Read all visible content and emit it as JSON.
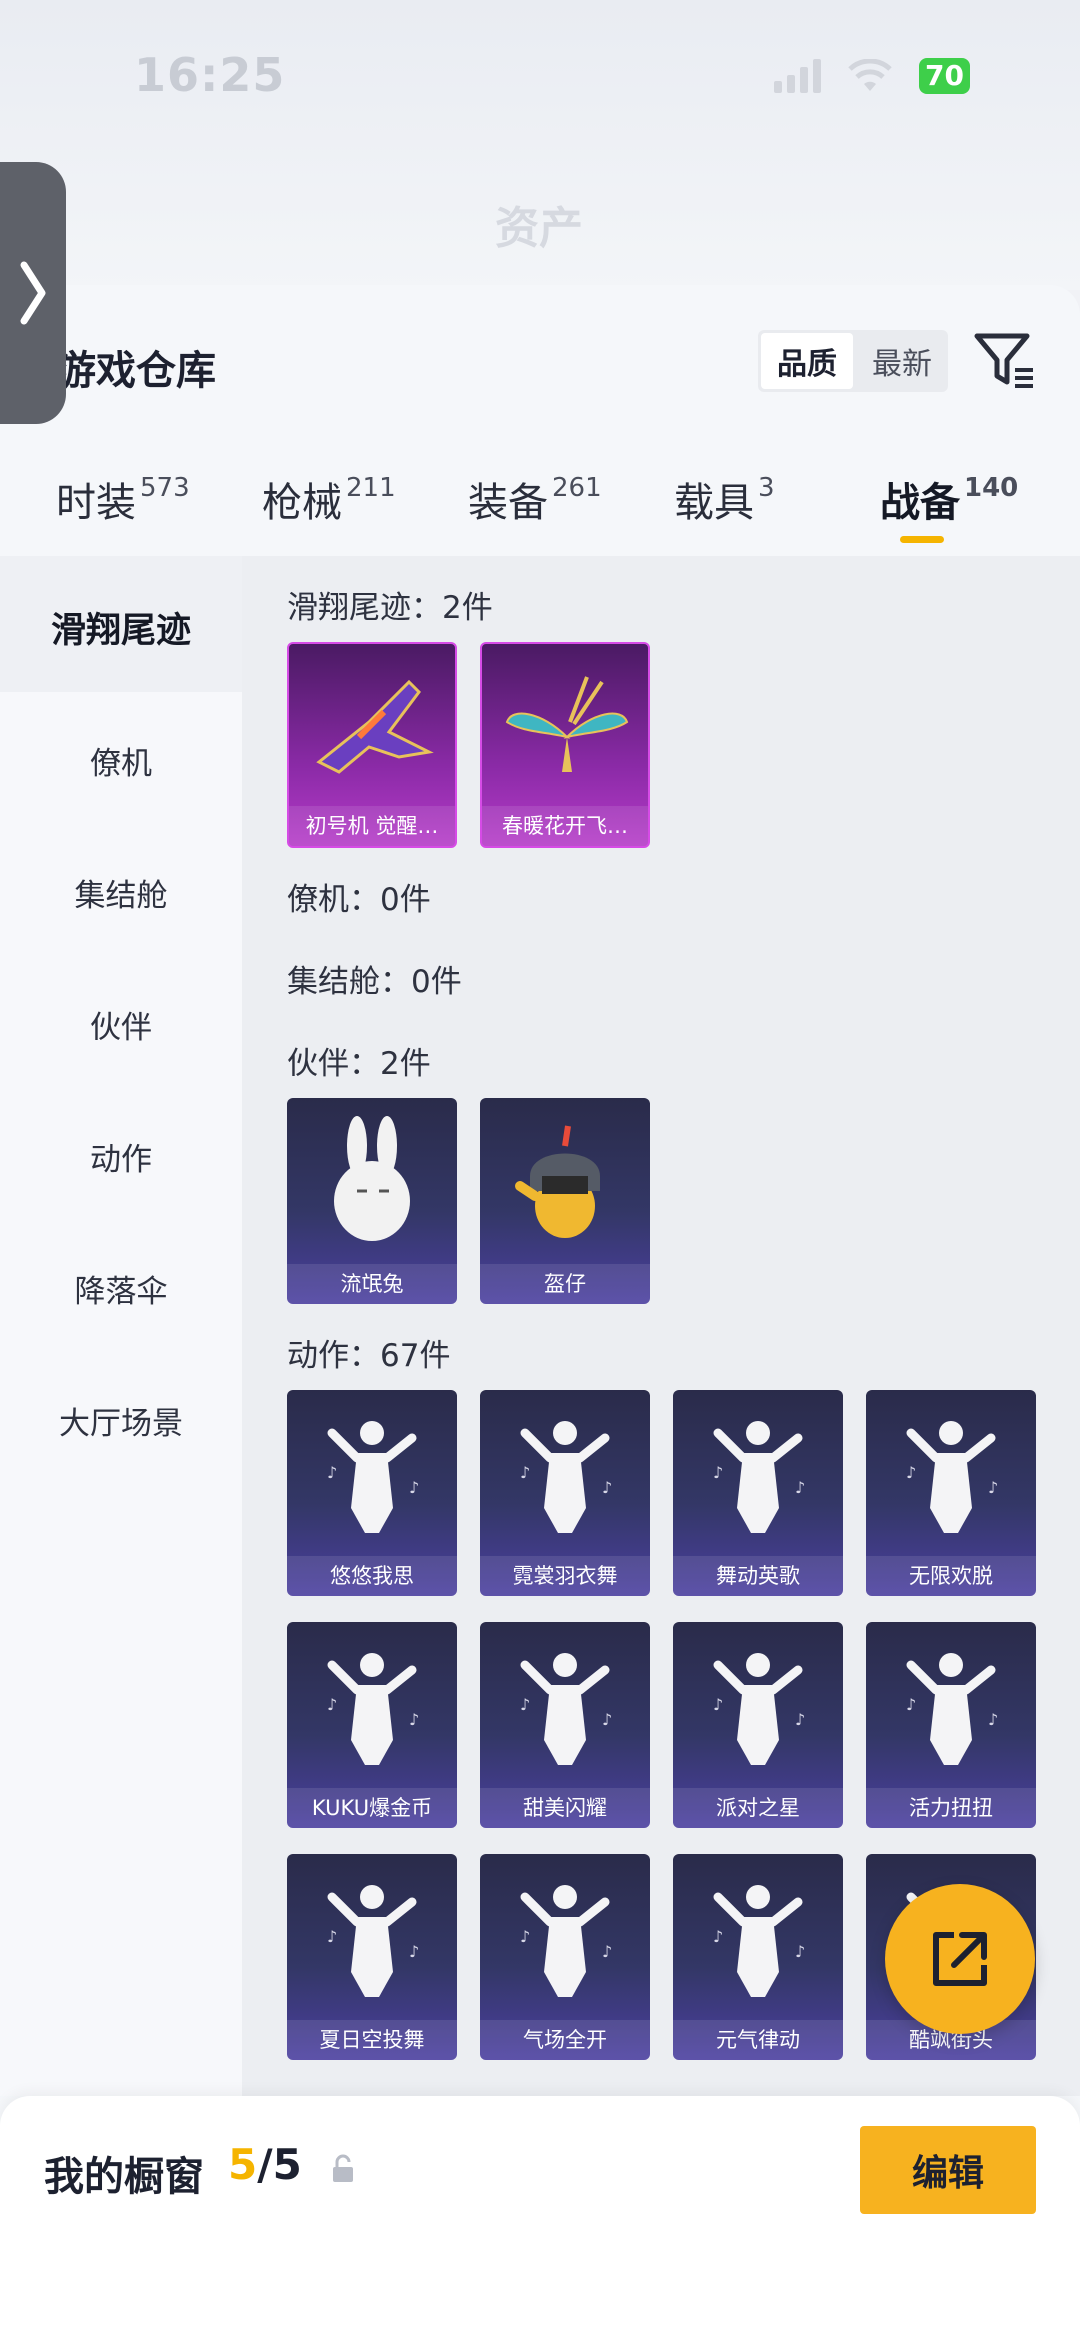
{
  "status": {
    "time": "16:25",
    "battery": "70"
  },
  "header": {
    "blurred_title": "资产",
    "title": "游戏仓库",
    "sort_options": [
      "品质",
      "最新"
    ],
    "active_sort": "品质"
  },
  "tabs": [
    {
      "label": "时装",
      "count": "573"
    },
    {
      "label": "枪械",
      "count": "211"
    },
    {
      "label": "装备",
      "count": "261"
    },
    {
      "label": "载具",
      "count": "3"
    },
    {
      "label": "战备",
      "count": "140",
      "active": true
    }
  ],
  "categories": [
    "滑翔尾迹",
    "僚机",
    "集结舱",
    "伙伴",
    "动作",
    "降落伞",
    "大厅场景"
  ],
  "sections": {
    "trails": {
      "label": "滑翔尾迹：2件",
      "items": [
        "初号机 觉醒…",
        "春暖花开飞…"
      ]
    },
    "wingman": {
      "label": "僚机：0件"
    },
    "capsule": {
      "label": "集结舱：0件"
    },
    "companion": {
      "label": "伙伴：2件",
      "items": [
        "流氓兔",
        "盔仔"
      ]
    },
    "emotes": {
      "label": "动作：67件",
      "items": [
        "悠悠我思",
        "霓裳羽衣舞",
        "舞动英歌",
        "无限欢脱",
        "KUKU爆金币",
        "甜美闪耀",
        "派对之星",
        "活力扭扭",
        "夏日空投舞",
        "气场全开",
        "元气律动",
        "酷飒街头"
      ]
    }
  },
  "showcase": {
    "label": "我的橱窗",
    "current": "5",
    "total": "/5",
    "edit_label": "编辑"
  },
  "colors": {
    "accent": "#f7b21f",
    "legendary": "#b53bc8",
    "epic": "#4b3fa0"
  }
}
